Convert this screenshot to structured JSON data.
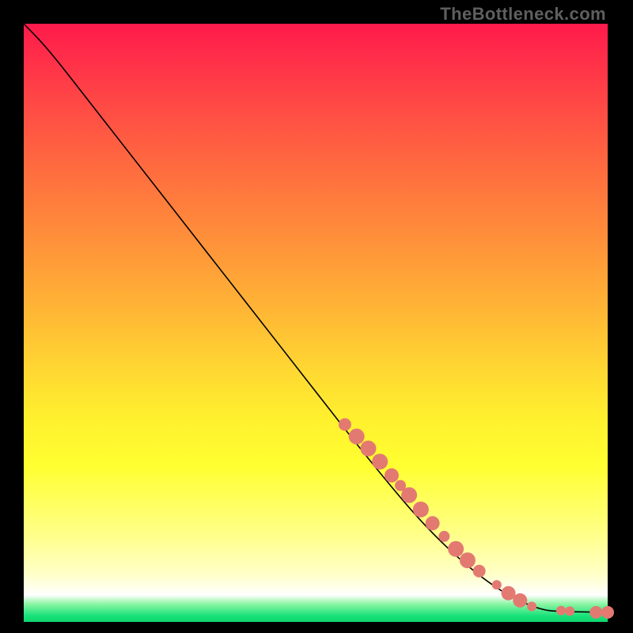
{
  "watermark": "TheBottleneck.com",
  "colors": {
    "marker_fill": "#e37a72",
    "curve_stroke": "#000000"
  },
  "chart_data": {
    "type": "line",
    "title": "",
    "xlabel": "",
    "ylabel": "",
    "xlim": [
      0,
      100
    ],
    "ylim": [
      0,
      100
    ],
    "grid": false,
    "legend": false,
    "curve": [
      {
        "x": 0,
        "y": 100
      },
      {
        "x": 3,
        "y": 97
      },
      {
        "x": 6,
        "y": 93.5
      },
      {
        "x": 10,
        "y": 88.5
      },
      {
        "x": 20,
        "y": 76.0
      },
      {
        "x": 30,
        "y": 63.5
      },
      {
        "x": 40,
        "y": 51.0
      },
      {
        "x": 50,
        "y": 38.5
      },
      {
        "x": 60,
        "y": 26.0
      },
      {
        "x": 70,
        "y": 14.5
      },
      {
        "x": 80,
        "y": 6.0
      },
      {
        "x": 88,
        "y": 2.0
      },
      {
        "x": 93,
        "y": 1.7
      },
      {
        "x": 95,
        "y": 1.7
      },
      {
        "x": 100,
        "y": 1.6
      }
    ],
    "markers": [
      {
        "x": 55,
        "y": 33.0,
        "r": 8
      },
      {
        "x": 57,
        "y": 31.0,
        "r": 10
      },
      {
        "x": 59,
        "y": 29.0,
        "r": 10
      },
      {
        "x": 61,
        "y": 26.8,
        "r": 10
      },
      {
        "x": 63,
        "y": 24.5,
        "r": 9
      },
      {
        "x": 64.5,
        "y": 22.8,
        "r": 7
      },
      {
        "x": 66,
        "y": 21.2,
        "r": 10
      },
      {
        "x": 68,
        "y": 18.8,
        "r": 10
      },
      {
        "x": 70,
        "y": 16.5,
        "r": 9
      },
      {
        "x": 72,
        "y": 14.3,
        "r": 7
      },
      {
        "x": 74,
        "y": 12.2,
        "r": 10
      },
      {
        "x": 76,
        "y": 10.3,
        "r": 10
      },
      {
        "x": 78,
        "y": 8.5,
        "r": 8
      },
      {
        "x": 81,
        "y": 6.2,
        "r": 6
      },
      {
        "x": 83,
        "y": 4.8,
        "r": 9
      },
      {
        "x": 85,
        "y": 3.6,
        "r": 9
      },
      {
        "x": 87,
        "y": 2.6,
        "r": 6
      },
      {
        "x": 92,
        "y": 1.9,
        "r": 6
      },
      {
        "x": 93.5,
        "y": 1.8,
        "r": 6
      },
      {
        "x": 98,
        "y": 1.6,
        "r": 8
      },
      {
        "x": 100,
        "y": 1.6,
        "r": 8
      }
    ]
  }
}
